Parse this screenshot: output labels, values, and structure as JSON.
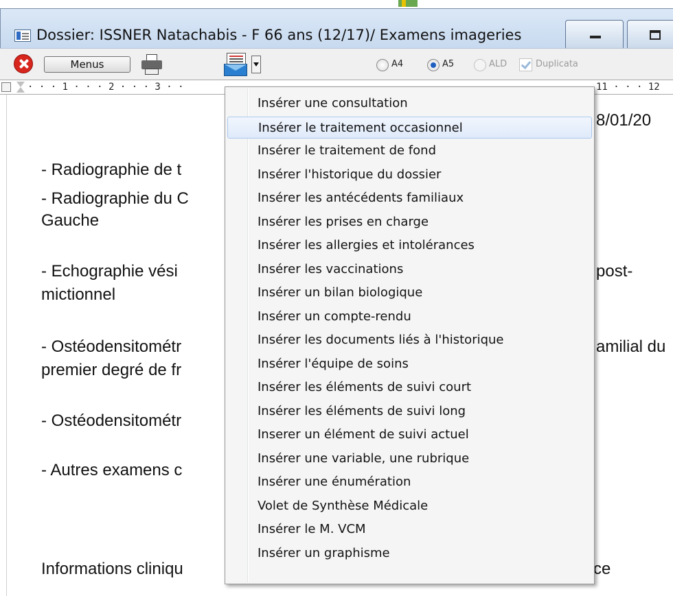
{
  "window": {
    "title": "Dossier: ISSNER Natachabis - F 66 ans (12/17)/ Examens imageries"
  },
  "toolbar": {
    "menus_label": "Menus",
    "radio_a4": "A4",
    "radio_a5": "A5",
    "radio_ald": "ALD",
    "duplicata": "Duplicata",
    "selected_format": "A5"
  },
  "ruler": {
    "left": "· · · 1 · · · 2 · · · 3 · ·",
    "right": "11 · · · 12"
  },
  "document": {
    "date_fragment": "8/01/20",
    "lines": [
      "- Radiographie de t",
      "- Radiographie du C",
      "Gauche",
      "- Echographie vési",
      "mictionnel",
      "- Ostéodensitométr",
      "premier degré de fr",
      "- Ostéodensitométr",
      "- Autres examens c",
      "Informations cliniqu"
    ],
    "right_fragments": {
      "post": "post-",
      "familial": "amilial du",
      "ce": "ce"
    }
  },
  "menu": {
    "highlighted_index": 1,
    "items": [
      "Insérer une consultation",
      "Insérer le traitement occasionnel",
      "Insérer le traitement de fond",
      "Insérer l'historique du dossier",
      "Insérer les antécédents familiaux",
      "Insérer les prises en charge",
      "Insérer les allergies et intolérances",
      "Insérer les vaccinations",
      "Insérer un bilan biologique",
      "Insérer un compte-rendu",
      "Insérer les documents liés à l'historique",
      "Insérer l'équipe de soins",
      "Insérer les éléments de suivi court",
      "Insérer les éléments de suivi long",
      "Inserer un élément de suivi actuel",
      "Insérer une variable, une rubrique",
      "Insérer une énumération",
      "Volet de Synthèse Médicale",
      "Insérer le M. VCM",
      "Insérer un graphisme"
    ]
  }
}
